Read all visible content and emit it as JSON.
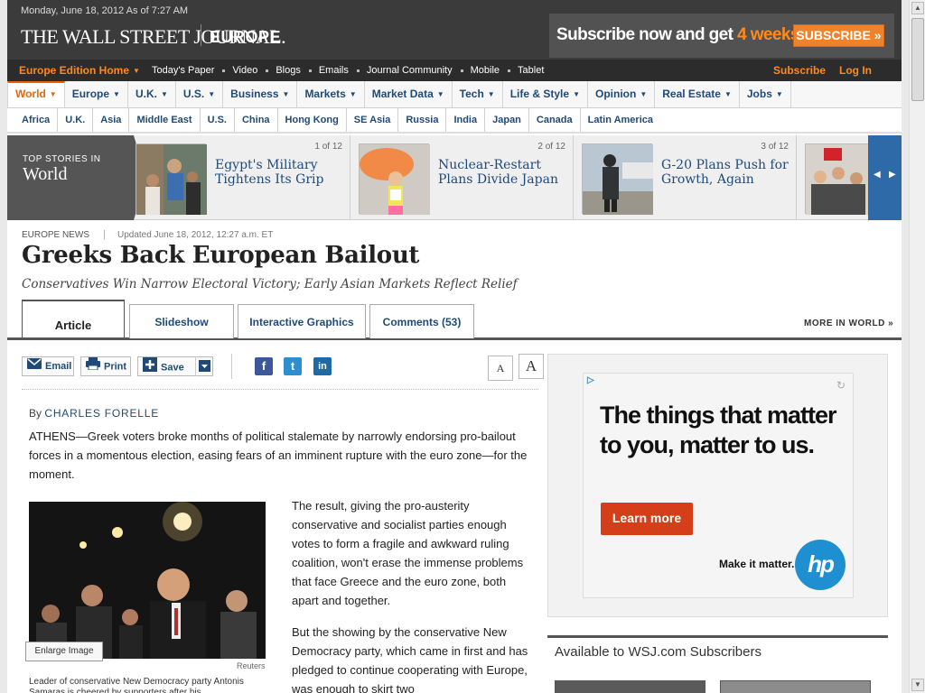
{
  "masthead": {
    "dateline": "Monday, June 18, 2012 As of 7:27 AM",
    "logo": "THE WALL STREET JOURNAL.",
    "edition": "EUROPE",
    "promo_text": "Subscribe now and get ",
    "promo_highlight": "4 weeks free",
    "promo_button": "SUBSCRIBE »"
  },
  "utility": {
    "edition_home": "Europe Edition Home",
    "links": [
      "Today's Paper",
      "Video",
      "Blogs",
      "Emails",
      "Journal Community",
      "Mobile",
      "Tablet"
    ],
    "subscribe": "Subscribe",
    "login": "Log In"
  },
  "nav": {
    "items": [
      "World",
      "Europe",
      "U.K.",
      "U.S.",
      "Business",
      "Markets",
      "Market Data",
      "Tech",
      "Life & Style",
      "Opinion",
      "Real Estate",
      "Jobs"
    ],
    "active_index": 0
  },
  "regions": [
    "Africa",
    "U.K.",
    "Asia",
    "Middle East",
    "U.S.",
    "China",
    "Hong Kong",
    "SE Asia",
    "Russia",
    "India",
    "Japan",
    "Canada",
    "Latin America"
  ],
  "top_stories": {
    "label_small": "TOP STORIES IN",
    "label_big": "World",
    "stories": [
      {
        "count": "1 of 12",
        "title": "Egypt's Military Tightens Its Grip"
      },
      {
        "count": "2 of 12",
        "title": "Nuclear-Restart Plans Divide Japan"
      },
      {
        "count": "3 of 12",
        "title": "G-20 Plans Push for Growth, Again"
      }
    ]
  },
  "article": {
    "kicker": "EUROPE NEWS",
    "kicker_sep": "|",
    "updated": "Updated June 18, 2012, 12:27 a.m. ET",
    "headline": "Greeks Back European Bailout",
    "dek": "Conservatives Win Narrow Electoral Victory; Early Asian Markets Reflect Relief",
    "tabs": [
      "Article",
      "Slideshow",
      "Interactive Graphics",
      "Comments (53)"
    ],
    "more_link": "MORE IN WORLD »",
    "toolbar": {
      "email": "Email",
      "print": "Print",
      "save": "Save"
    },
    "byline_prefix": "By",
    "byline_name": "CHARLES FORELLE",
    "p1": "ATHENS—Greek voters broke months of political stalemate by narrowly endorsing pro-bailout forces in a momentous election, easing fears of an imminent rupture with the euro zone—for the moment.",
    "p2": "The result, giving the pro-austerity conservative and socialist parties enough votes to form a fragile and awkward ruling coalition, won't erase the immense problems that face Greece and the euro zone, both apart and together.",
    "p3": "But the showing by the conservative New Democracy party, which came in first and has pledged to continue cooperating with Europe, was enough to skirt two",
    "enlarge": "Enlarge Image",
    "credit": "Reuters",
    "caption": "Leader of conservative New Democracy party Antonis Samaras is cheered by supporters after his"
  },
  "ad": {
    "headline": "The things that matter to you, matter to us.",
    "button": "Learn more",
    "tagline": "Make it matter.",
    "logo": "hp"
  },
  "subscribers": {
    "title": "Available to WSJ.com Subscribers"
  },
  "colors": {
    "accent": "#e8650c",
    "link": "#1f4a78",
    "masthead": "#3b3b3b"
  }
}
